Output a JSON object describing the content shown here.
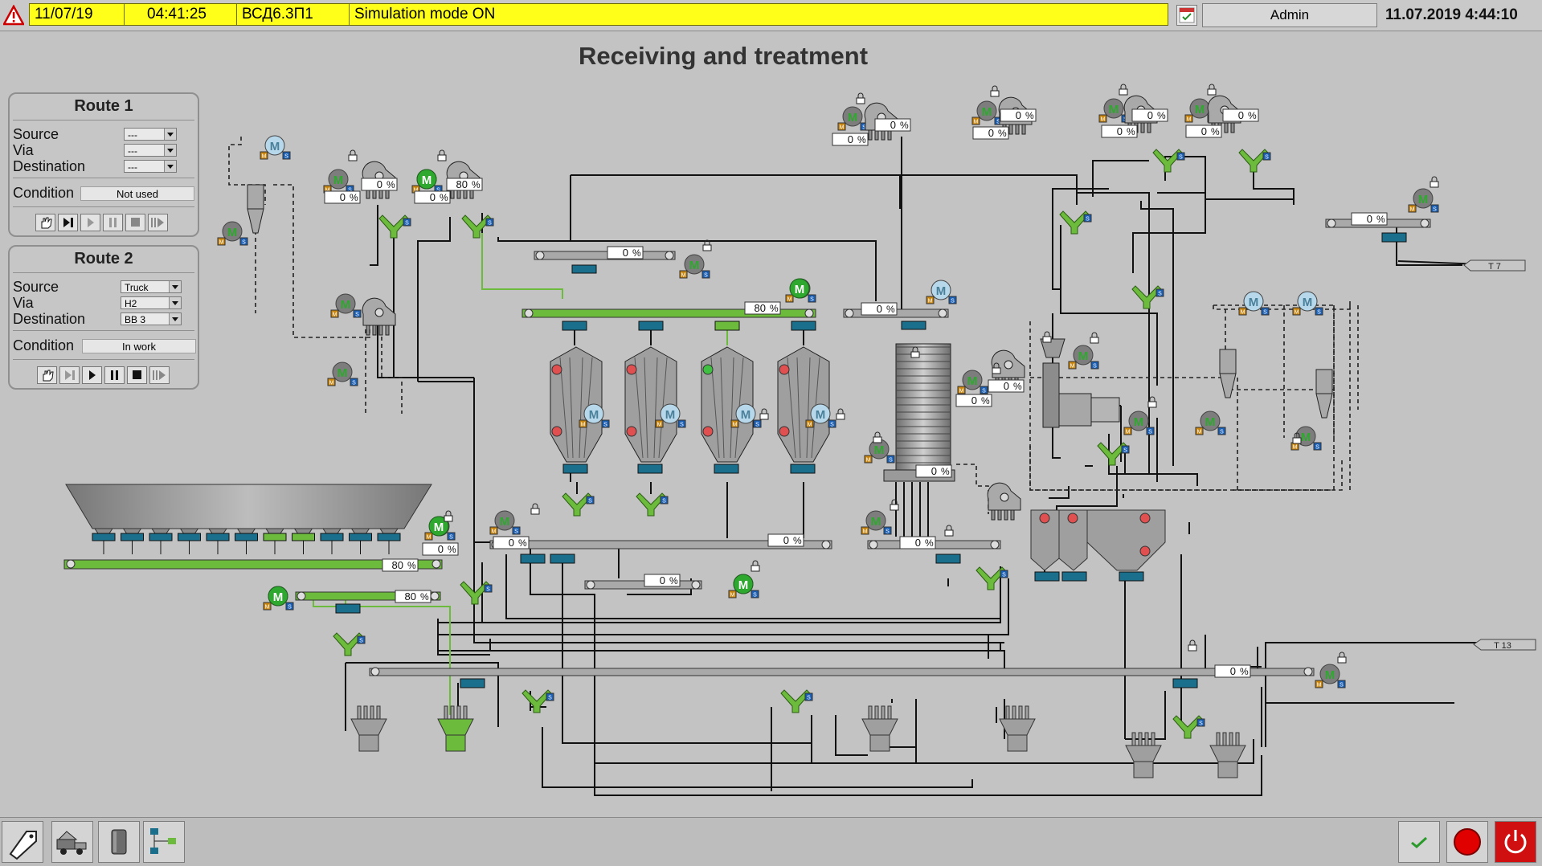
{
  "status": {
    "date": "11/07/19",
    "time": "04:41:25",
    "code": "ВСД6.3П1",
    "message": "Simulation mode ON",
    "user": "Admin",
    "clock": "11.07.2019 4:44:10"
  },
  "title": "Receiving and treatment",
  "route1": {
    "title": "Route 1",
    "labels": {
      "source": "Source",
      "via": "Via",
      "destination": "Destination",
      "condition": "Condition"
    },
    "source": "---",
    "via": "---",
    "destination": "---",
    "condition": "Not used"
  },
  "route2": {
    "title": "Route 2",
    "labels": {
      "source": "Source",
      "via": "Via",
      "destination": "Destination",
      "condition": "Condition"
    },
    "source": "Truck",
    "via": "H2",
    "destination": "BB 3",
    "condition": "In work"
  },
  "process": {
    "motor_label": "M",
    "badge_m": "M",
    "badge_s": "S",
    "percent_unit": "%",
    "values": {
      "feeder_0a": "0",
      "feeder_0b": "0",
      "feeder_80a": "80",
      "feeder_0c": "0",
      "conv_top": "0",
      "conv_green": "80",
      "conv_mid": "0",
      "dryer_feed": "0",
      "dryer_out": "0",
      "dryer_top_a": "0",
      "dryer_top_b": "0",
      "aspir_1a": "0",
      "aspir_1b": "0",
      "aspir_2a": "0",
      "aspir_2b": "0",
      "aspir_3a": "0",
      "aspir_3b": "0",
      "conv_right": "0",
      "hopper_pct": "0",
      "hopper_conv": "80",
      "small_conv": "80",
      "lower_left": "0",
      "lower_right": "0",
      "lower_mid": "0",
      "bottom_long": "0",
      "right_conv": "0",
      "dryer_side": "0"
    },
    "targets": {
      "t7": "T 7",
      "t13": "T 13"
    },
    "colors": {
      "active": "#6dbb3c",
      "idle": "#8a8a8a",
      "gate": "#1a6f8c",
      "motor_on": "#2fa82f",
      "motor_off": "#7d7d7d"
    }
  },
  "bottom": {
    "nav": [
      "tag-icon",
      "truck-icon",
      "silo-icon",
      "network-icon"
    ],
    "right": [
      "check-icon",
      "stop-icon",
      "power-icon"
    ]
  }
}
